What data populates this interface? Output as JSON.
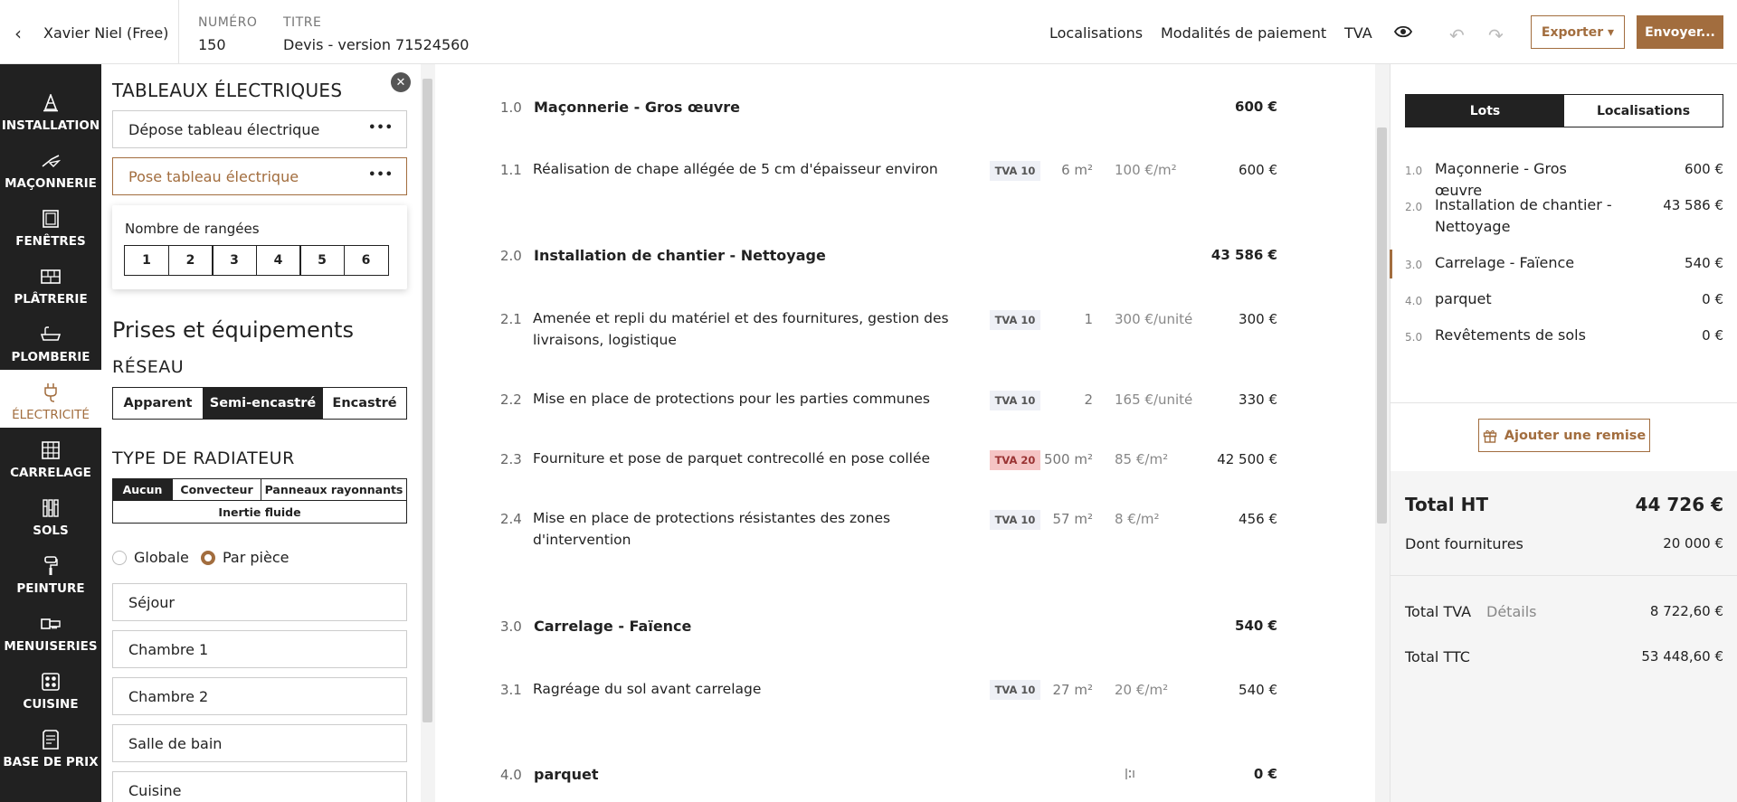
{
  "header": {
    "client": "Xavier Niel (Free)",
    "numero_label": "NUMÉRO",
    "numero_value": "150",
    "titre_label": "TITRE",
    "titre_value": "Devis - version 71524560",
    "links": [
      "Localisations",
      "Modalités de paiement",
      "TVA"
    ],
    "export_label": "Exporter ▾",
    "send_label": "Envoyer..."
  },
  "nav": [
    {
      "label": "INSTALLATION",
      "icon": "cone-icon"
    },
    {
      "label": "MAÇONNERIE",
      "icon": "trowel-icon"
    },
    {
      "label": "FENÊTRES",
      "icon": "window-icon"
    },
    {
      "label": "PLÂTRERIE",
      "icon": "brick-icon"
    },
    {
      "label": "PLOMBERIE",
      "icon": "bathtub-icon"
    },
    {
      "label": "ÉLECTRICITÉ",
      "icon": "plug-icon",
      "active": true
    },
    {
      "label": "CARRELAGE",
      "icon": "tiles-icon"
    },
    {
      "label": "SOLS",
      "icon": "floor-icon"
    },
    {
      "label": "PEINTURE",
      "icon": "paint-roller-icon"
    },
    {
      "label": "MENUISERIES",
      "icon": "saw-icon"
    },
    {
      "label": "CUISINE",
      "icon": "stove-icon"
    },
    {
      "label": "BASE DE PRIX",
      "icon": "price-list-icon"
    }
  ],
  "config": {
    "section_title": "TABLEAUX ÉLECTRIQUES",
    "items": [
      "Dépose tableau électrique",
      "Pose tableau électrique"
    ],
    "rows_label": "Nombre de rangées",
    "rows_options": [
      "1",
      "2",
      "3",
      "4",
      "5",
      "6"
    ],
    "prises_title": "Prises et équipements",
    "reseau_title": "RÉSEAU",
    "reseau_options": [
      "Apparent",
      "Semi-encastré",
      "Encastré"
    ],
    "reseau_selected": "Semi-encastré",
    "radiateur_title": "TYPE DE RADIATEUR",
    "radiateur_options": [
      "Aucun",
      "Convecteur",
      "Panneaux rayonnants",
      "Inertie fluide"
    ],
    "radiateur_selected": "Aucun",
    "scope_options": [
      "Globale",
      "Par pièce"
    ],
    "scope_selected": "Par pièce",
    "rooms": [
      "Séjour",
      "Chambre 1",
      "Chambre 2",
      "Salle de bain",
      "Cuisine"
    ]
  },
  "lines": [
    {
      "num": "1.0",
      "title": "Maçonnerie - Gros œuvre",
      "amount": "600 €",
      "header": true
    },
    {
      "num": "1.1",
      "title": "Réalisation de chape allégée de 5 cm d'épaisseur environ",
      "tva": "TVA 10",
      "qty": "6 m²",
      "unit_price": "100 €/m²",
      "amount": "600 €"
    },
    {
      "num": "2.0",
      "title": "Installation de chantier - Nettoyage",
      "amount": "43 586 €",
      "header": true
    },
    {
      "num": "2.1",
      "title": "Amenée et repli du matériel et des fournitures, gestion des livraisons, logistique",
      "tva": "TVA 10",
      "qty": "1",
      "unit_price": "300 €/unité",
      "amount": "300 €"
    },
    {
      "num": "2.2",
      "title": "Mise en place de protections pour les parties communes",
      "tva": "TVA 10",
      "qty": "2",
      "unit_price": "165 €/unité",
      "amount": "330 €"
    },
    {
      "num": "2.3",
      "title": "Fourniture et pose de parquet contrecollé en pose collée",
      "tva": "TVA 20",
      "qty": "500 m²",
      "unit_price": "85 €/m²",
      "amount": "42 500 €"
    },
    {
      "num": "2.4",
      "title": "Mise en place de protections résistantes des zones d'intervention",
      "tva": "TVA 10",
      "qty": "57 m²",
      "unit_price": "8 €/m²",
      "amount": "456 €"
    },
    {
      "num": "3.0",
      "title": "Carrelage - Faïence",
      "amount": "540 €",
      "header": true
    },
    {
      "num": "3.1",
      "title": "Ragréage du sol avant carrelage",
      "tva": "TVA 10",
      "qty": "27 m²",
      "unit_price": "20 €/m²",
      "amount": "540 €"
    },
    {
      "num": "4.0",
      "title": "parquet",
      "amount": "0 €",
      "header": true
    }
  ],
  "summary": {
    "tabs": [
      "Lots",
      "Localisations"
    ],
    "tab_selected": "Lots",
    "lots": [
      {
        "num": "1.0",
        "name": "Maçonnerie - Gros œuvre",
        "amount": "600 €"
      },
      {
        "num": "2.0",
        "name": "Installation de chantier - Nettoyage",
        "amount": "43 586 €"
      },
      {
        "num": "3.0",
        "name": "Carrelage - Faïence",
        "amount": "540 €"
      },
      {
        "num": "4.0",
        "name": "parquet",
        "amount": "0 €"
      },
      {
        "num": "5.0",
        "name": "Revêtements de sols",
        "amount": "0 €"
      }
    ],
    "remise_label": "Ajouter une remise",
    "total_ht_label": "Total HT",
    "total_ht": "44 726 €",
    "fournitures_label": "Dont fournitures",
    "fournitures": "20 000 €",
    "total_tva_label": "Total TVA",
    "details_label": "Détails",
    "total_tva": "8 722,60 €",
    "total_ttc_label": "Total TTC",
    "total_ttc": "53 448,60 €"
  },
  "colors": {
    "accent": "#a26d3e",
    "dark": "#212121",
    "tva_warn": "#f5c4c4"
  }
}
